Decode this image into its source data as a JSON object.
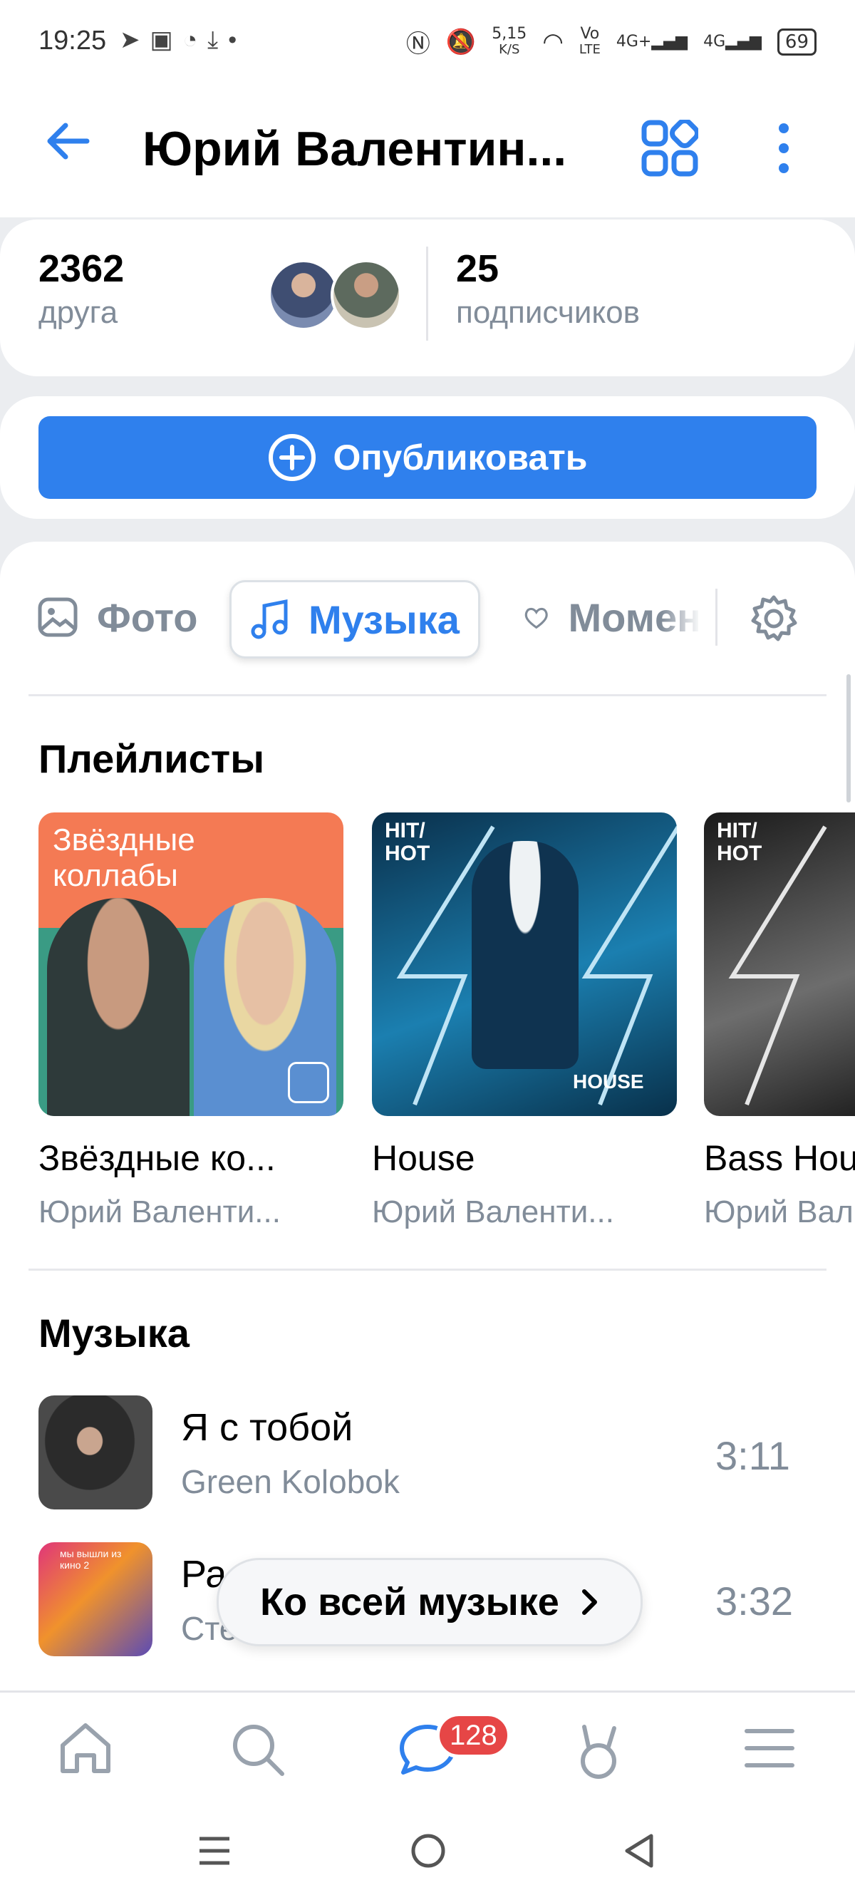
{
  "status_bar": {
    "time": "19:25",
    "left_icons": [
      "telegram-icon",
      "message-icon",
      "chat-icon",
      "download-icon",
      "dot-icon"
    ],
    "net_speed_value": "5,15",
    "net_speed_unit": "K/S",
    "volte": "Vo",
    "volte_lte": "LTE",
    "signal1": "4G+",
    "signal2": "4G",
    "battery": "69"
  },
  "header": {
    "title": "Юрий Валентин..."
  },
  "stats": {
    "friends_count": "2362",
    "friends_label": "друга",
    "followers_count": "25",
    "followers_label": "подписчиков"
  },
  "publish": {
    "label": "Опубликовать"
  },
  "tabs": [
    {
      "label": "Фото",
      "icon": "photo-icon"
    },
    {
      "label": "Музыка",
      "icon": "music-note-icon",
      "active": true
    },
    {
      "label": "Момен",
      "icon": "moments-icon"
    }
  ],
  "playlists": {
    "title": "Плейлисты",
    "items": [
      {
        "cover_text": "Звёздные коллабы",
        "title": "Звёздные ко...",
        "owner": "Юрий Валенти..."
      },
      {
        "cover_brand": "HIT/ HOT",
        "cover_label": "HOUSE",
        "title": "House",
        "owner": "Юрий Валенти..."
      },
      {
        "cover_brand": "HIT/ HOT",
        "title": "Bass Hou",
        "owner": "Юрий Вал"
      }
    ]
  },
  "music": {
    "title": "Музыка",
    "tracks": [
      {
        "title": "Я с тобой",
        "artist": "Green Kolobok",
        "duration": "3:11"
      },
      {
        "title": "Ра",
        "artist": "Сте",
        "duration": "3:32",
        "cover_text": "мы вышли из кино 2"
      }
    ],
    "all_music_label": "Ко всей музыке"
  },
  "bottom_nav": {
    "messages_badge": "128",
    "items": [
      "home-icon",
      "search-icon",
      "messages-icon",
      "clips-icon",
      "menu-icon"
    ]
  },
  "colors": {
    "accent": "#2f80ed",
    "badge": "#e64646",
    "secondary_text": "#818c99",
    "background": "#ebedf0"
  }
}
